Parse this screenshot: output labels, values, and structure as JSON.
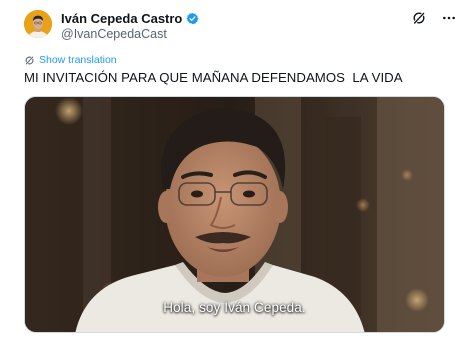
{
  "author": {
    "display_name": "Iván Cepeda Castro",
    "handle": "@IvanCepedaCast",
    "verified": true
  },
  "icons": {
    "avatar": "profile-avatar",
    "verified": "verified-badge-icon",
    "grok": "grok-icon",
    "more": "more-options-icon",
    "translate": "translate-icon"
  },
  "translate": {
    "label": "Show translation"
  },
  "tweet": {
    "text": "MI INVITACIÓN PARA QUE MAÑANA DEFENDAMOS  LA VIDA"
  },
  "media": {
    "subtitle": "Hola, soy Iván Cepeda."
  },
  "colors": {
    "accent": "#1d9bf0",
    "avatar_bg": "#e8a21a",
    "text_primary": "#0f1419",
    "text_secondary": "#536471"
  }
}
